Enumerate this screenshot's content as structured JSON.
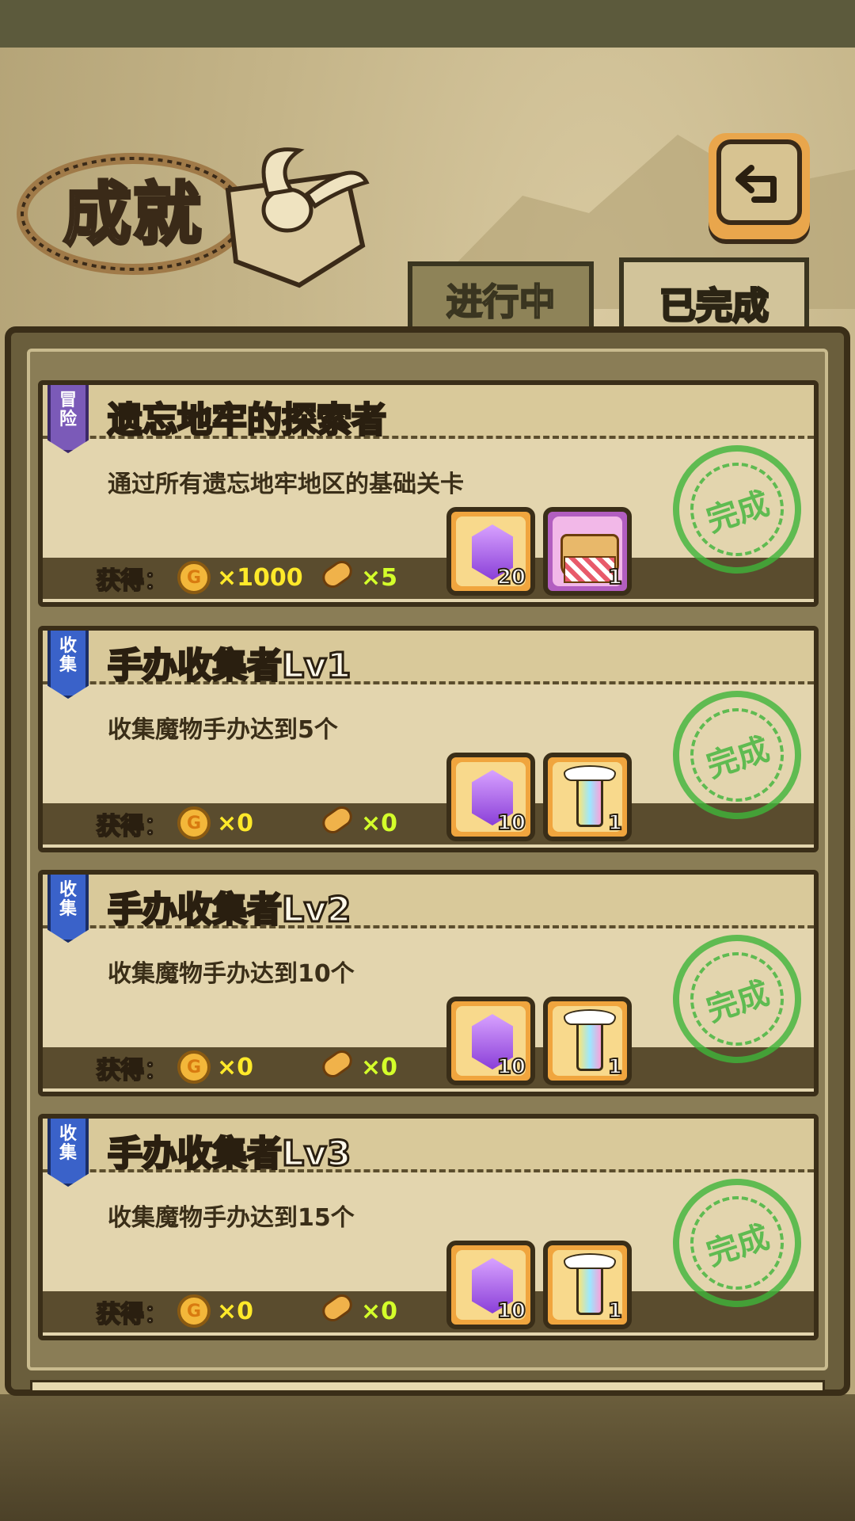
{
  "page": {
    "title": "成就",
    "back_icon": "return-arrow-icon"
  },
  "tabs": [
    {
      "label": "进行中",
      "active": false
    },
    {
      "label": "已完成",
      "active": true
    }
  ],
  "colors": {
    "gold": "#ffe92a",
    "lime": "#d4ff2a",
    "stamp_green": "#3fb53a",
    "badge_blue": "#3a62c9",
    "badge_purple": "#7b5ab8"
  },
  "achievements": [
    {
      "badge": [
        "冒",
        "险"
      ],
      "badge_color": "purple",
      "title": "遗忘地牢的探索者",
      "desc": "通过所有遗忘地牢地区的基础关卡",
      "reward_label": "获得：",
      "coin": "×1000",
      "bread": "×5",
      "items": [
        {
          "icon": "purple-gem-icon",
          "count": "20",
          "frame": "orange"
        },
        {
          "icon": "bread-basket-icon",
          "count": "1",
          "frame": "pink"
        }
      ],
      "stamp": "完成"
    },
    {
      "badge": [
        "收",
        "集"
      ],
      "badge_color": "blue",
      "title": "手办收集者Lv1",
      "desc": "收集魔物手办达到5个",
      "reward_label": "获得：",
      "coin": "×0",
      "bread": "×0",
      "items": [
        {
          "icon": "purple-gem-icon",
          "count": "10",
          "frame": "orange"
        },
        {
          "icon": "winged-bottle-icon",
          "count": "1",
          "frame": "orange"
        }
      ],
      "stamp": "完成"
    },
    {
      "badge": [
        "收",
        "集"
      ],
      "badge_color": "blue",
      "title": "手办收集者Lv2",
      "desc": "收集魔物手办达到10个",
      "reward_label": "获得：",
      "coin": "×0",
      "bread": "×0",
      "items": [
        {
          "icon": "purple-gem-icon",
          "count": "10",
          "frame": "orange"
        },
        {
          "icon": "winged-bottle-icon",
          "count": "1",
          "frame": "orange"
        }
      ],
      "stamp": "完成"
    },
    {
      "badge": [
        "收",
        "集"
      ],
      "badge_color": "blue",
      "title": "手办收集者Lv3",
      "desc": "收集魔物手办达到15个",
      "reward_label": "获得：",
      "coin": "×0",
      "bread": "×0",
      "items": [
        {
          "icon": "purple-gem-icon",
          "count": "10",
          "frame": "orange"
        },
        {
          "icon": "winged-bottle-icon",
          "count": "1",
          "frame": "orange"
        }
      ],
      "stamp": "完成"
    }
  ]
}
